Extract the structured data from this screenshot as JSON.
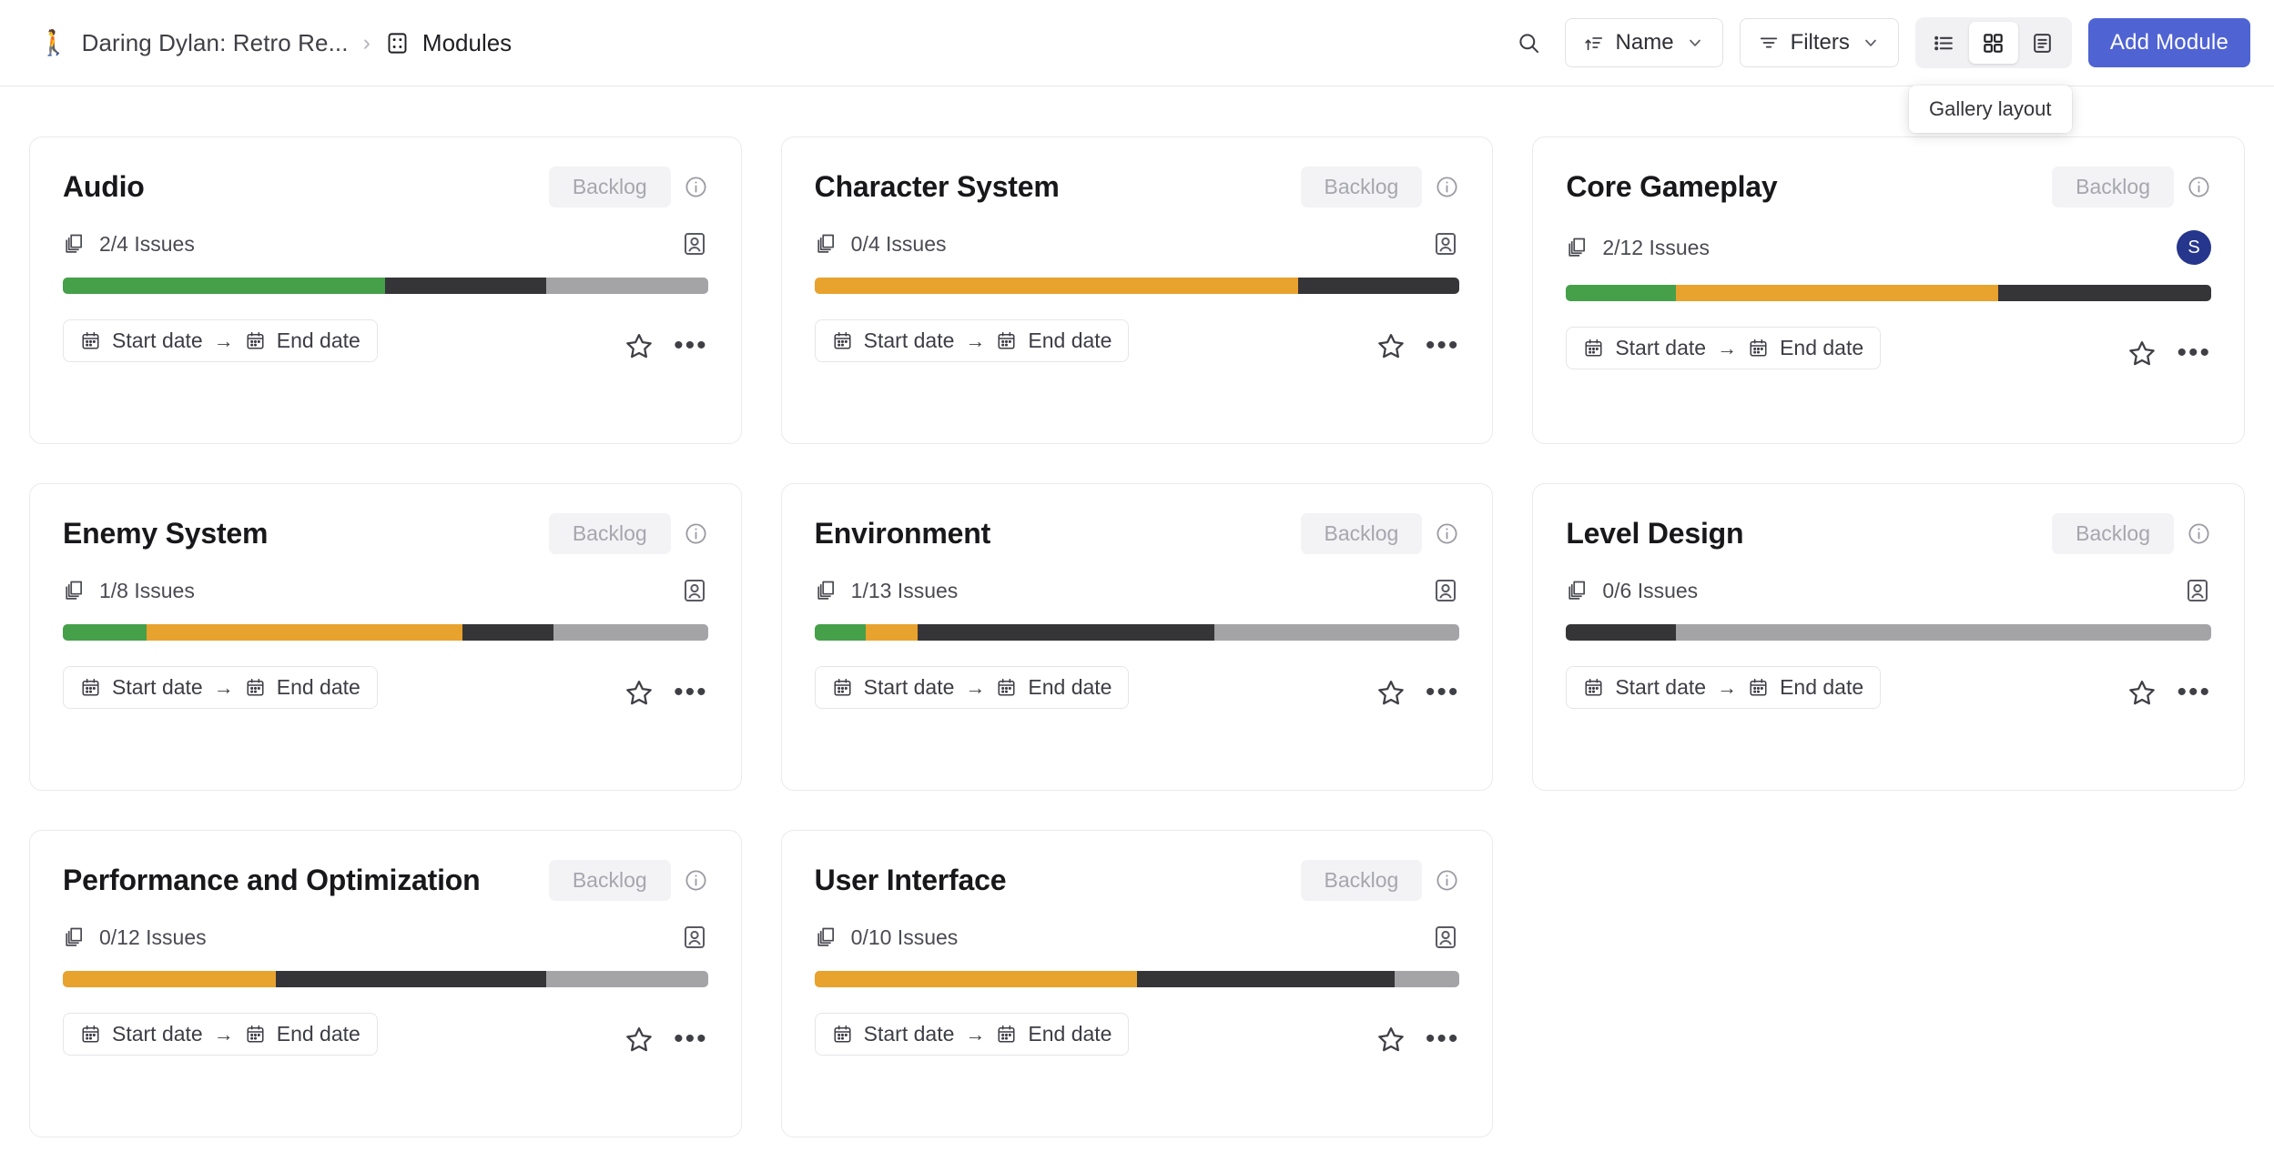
{
  "header": {
    "project_emoji": "🚶",
    "project_name": "Daring Dylan: Retro Re...",
    "separator": "›",
    "section_icon": "modules-icon",
    "section_name": "Modules",
    "search_icon": "search-icon",
    "sort": {
      "label": "Name",
      "icon": "sort-icon",
      "chevron": "chevron-down-icon"
    },
    "filters": {
      "label": "Filters",
      "icon": "filter-icon",
      "chevron": "chevron-down-icon"
    },
    "layouts": [
      {
        "name": "list-layout",
        "icon": "list-icon",
        "active": false
      },
      {
        "name": "gallery-layout",
        "icon": "grid-icon",
        "active": true
      },
      {
        "name": "spreadsheet-layout",
        "icon": "table-icon",
        "active": false
      }
    ],
    "add_button": "Add  Module",
    "tooltip": "Gallery layout",
    "accent_color": "#4f63d2"
  },
  "legend_colors": {
    "completed": "#45a049",
    "in_progress": "#e8a22e",
    "pending": "#353538",
    "backlog": "#a4a4a6",
    "track": "#f1f1f3"
  },
  "card_labels": {
    "issues_suffix": "Issues",
    "start_date": "Start date",
    "end_date": "End date",
    "date_arrow": "→",
    "state": "Backlog",
    "info_icon": "info-icon",
    "issues_icon": "layers-icon",
    "member_icon": "member-placeholder-icon",
    "star_icon": "star-icon",
    "menu_icon": "more-options-icon"
  },
  "modules": [
    {
      "title": "Audio",
      "state": "Backlog",
      "issues": "2/4 Issues",
      "issues_done": 2,
      "issues_total": 4,
      "lead": null,
      "progress": [
        {
          "color": "#45a049",
          "pct": 50
        },
        {
          "color": "#353538",
          "pct": 25
        },
        {
          "color": "#a4a4a6",
          "pct": 25
        }
      ]
    },
    {
      "title": "Character System",
      "state": "Backlog",
      "issues": "0/4 Issues",
      "issues_done": 0,
      "issues_total": 4,
      "lead": null,
      "progress": [
        {
          "color": "#e8a22e",
          "pct": 75
        },
        {
          "color": "#353538",
          "pct": 25
        }
      ]
    },
    {
      "title": "Core Gameplay",
      "state": "Backlog",
      "issues": "2/12 Issues",
      "issues_done": 2,
      "issues_total": 12,
      "lead": "S",
      "progress": [
        {
          "color": "#45a049",
          "pct": 17
        },
        {
          "color": "#e8a22e",
          "pct": 50
        },
        {
          "color": "#353538",
          "pct": 33
        }
      ]
    },
    {
      "title": "Enemy System",
      "state": "Backlog",
      "issues": "1/8 Issues",
      "issues_done": 1,
      "issues_total": 8,
      "lead": null,
      "progress": [
        {
          "color": "#45a049",
          "pct": 13
        },
        {
          "color": "#e8a22e",
          "pct": 49
        },
        {
          "color": "#353538",
          "pct": 14
        },
        {
          "color": "#a4a4a6",
          "pct": 24
        }
      ]
    },
    {
      "title": "Environment",
      "state": "Backlog",
      "issues": "1/13 Issues",
      "issues_done": 1,
      "issues_total": 13,
      "lead": null,
      "progress": [
        {
          "color": "#45a049",
          "pct": 8
        },
        {
          "color": "#e8a22e",
          "pct": 8
        },
        {
          "color": "#353538",
          "pct": 46
        },
        {
          "color": "#a4a4a6",
          "pct": 38
        }
      ]
    },
    {
      "title": "Level Design",
      "state": "Backlog",
      "issues": "0/6 Issues",
      "issues_done": 0,
      "issues_total": 6,
      "lead": null,
      "progress": [
        {
          "color": "#353538",
          "pct": 17
        },
        {
          "color": "#a4a4a6",
          "pct": 83
        }
      ]
    },
    {
      "title": "Performance and Optimization",
      "state": "Backlog",
      "issues": "0/12 Issues",
      "issues_done": 0,
      "issues_total": 12,
      "lead": null,
      "progress": [
        {
          "color": "#e8a22e",
          "pct": 33
        },
        {
          "color": "#353538",
          "pct": 42
        },
        {
          "color": "#a4a4a6",
          "pct": 25
        }
      ]
    },
    {
      "title": "User Interface",
      "state": "Backlog",
      "issues": "0/10 Issues",
      "issues_done": 0,
      "issues_total": 10,
      "lead": null,
      "progress": [
        {
          "color": "#e8a22e",
          "pct": 50
        },
        {
          "color": "#353538",
          "pct": 40
        },
        {
          "color": "#a4a4a6",
          "pct": 10
        }
      ]
    }
  ]
}
